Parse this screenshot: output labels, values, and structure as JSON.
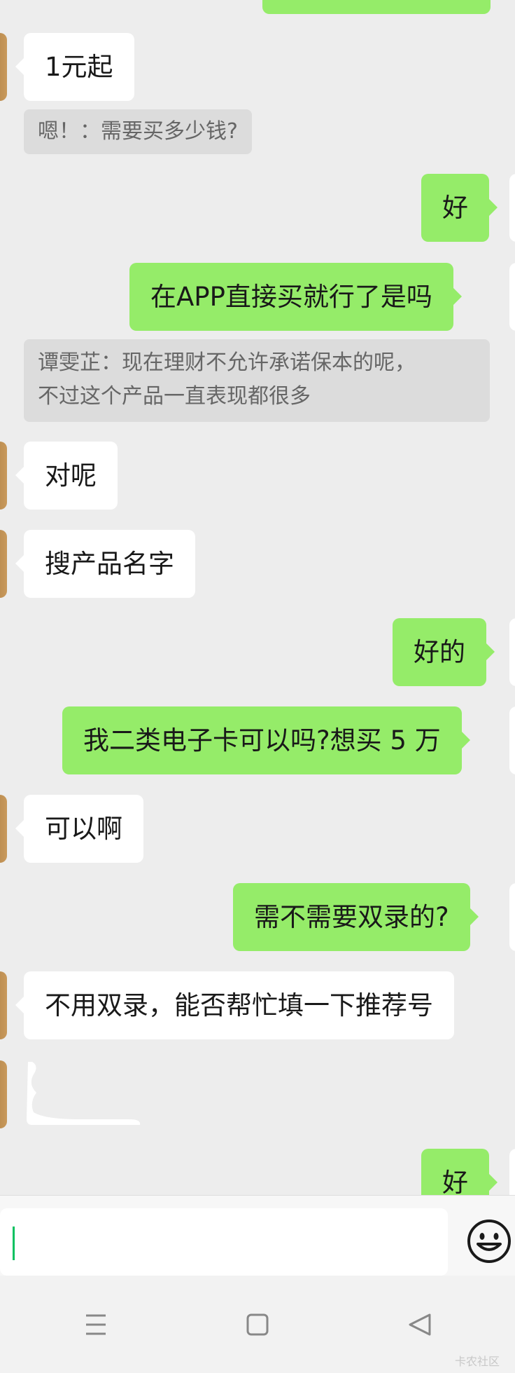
{
  "messages": {
    "m1": "1元起",
    "q1": "嗯！：需要买多少钱?",
    "m2": "好",
    "m3": "在APP直接买就行了是吗",
    "q2_line1": "谭雯芷：现在理财不允许承诺保本的呢，",
    "q2_line2": "不过这个产品一直表现都很多",
    "m4": "对呢",
    "m5": "搜产品名字",
    "m6": "好的",
    "m7": "我二类电子卡可以吗?想买 5 万",
    "m8": "可以啊",
    "m9": "需不需要双录的?",
    "m10": "不用双录，能否帮忙填一下推荐号",
    "m11": "好"
  },
  "input": {
    "value": "",
    "emoji_icon": "smiley-face-icon"
  },
  "nav": {
    "icons": [
      "menu-icon",
      "home-square-icon",
      "back-triangle-icon"
    ]
  },
  "watermark": "卡农社区",
  "colors": {
    "outgoing_bubble": "#95ec69",
    "incoming_bubble": "#ffffff",
    "background": "#ededed",
    "cursor": "#07c160"
  }
}
